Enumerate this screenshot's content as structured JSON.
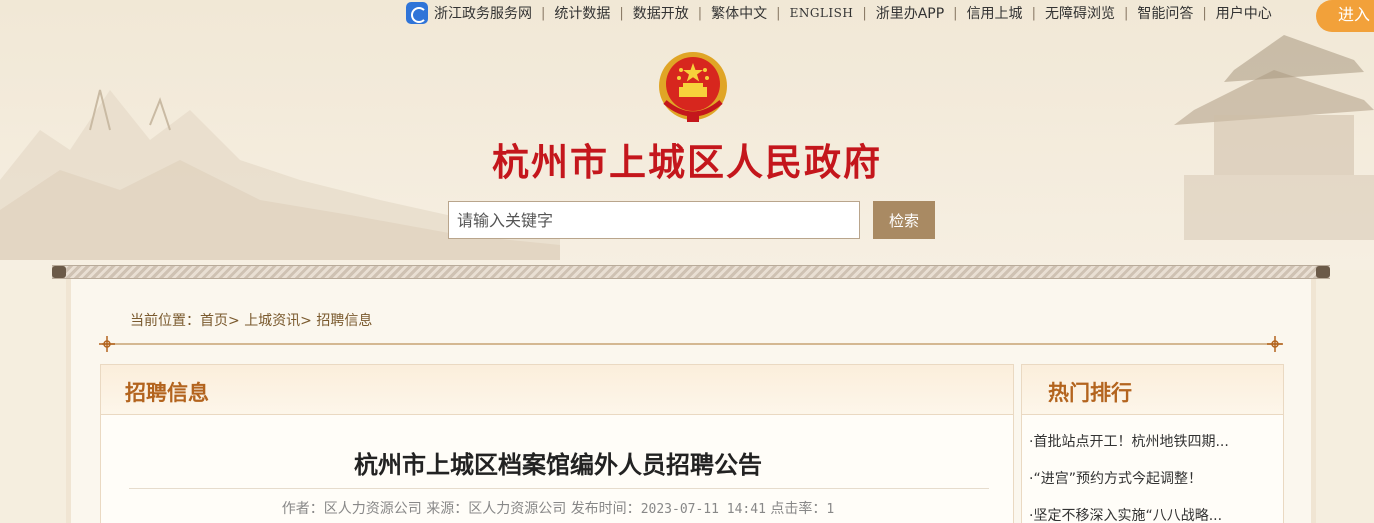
{
  "topbar": {
    "links": [
      {
        "label": "浙江政务服务网"
      },
      {
        "label": "统计数据"
      },
      {
        "label": "数据开放"
      },
      {
        "label": "繁体中文"
      },
      {
        "label": "ENGLISH"
      },
      {
        "label": "浙里办APP"
      },
      {
        "label": "信用上城"
      },
      {
        "label": "无障碍浏览"
      },
      {
        "label": "智能问答"
      },
      {
        "label": "用户中心"
      }
    ],
    "separator": "|",
    "enter_label": "进入"
  },
  "header": {
    "site_title": "杭州市上城区人民政府"
  },
  "search": {
    "placeholder": "请输入关键字",
    "button_label": "检索"
  },
  "breadcrumb": {
    "prefix": "当前位置：",
    "items": [
      "首页>",
      "上城资讯>",
      "招聘信息"
    ]
  },
  "main": {
    "section_title": "招聘信息",
    "article_title": "杭州市上城区档案馆编外人员招聘公告",
    "meta": {
      "author_label": "作者：",
      "author": "区人力资源公司",
      "source_label": "来源：",
      "source": "区人力资源公司",
      "published_label": "发布时间：",
      "published": "2023-07-11 14:41",
      "clicks_label": "点击率：",
      "clicks": "1"
    }
  },
  "sidebar": {
    "section_title": "热门排行",
    "items": [
      {
        "label": "·首批站点开工！杭州地铁四期..."
      },
      {
        "label": "·“进宫”预约方式今起调整！"
      },
      {
        "label": "·坚定不移深入实施“八八战略..."
      }
    ]
  },
  "colors": {
    "brand_red": "#c4161c",
    "accent_brown": "#b3641e",
    "button_brown": "#a98a63",
    "enter_orange": "#f2a13a"
  },
  "icons": [
    "zhejiang-service-icon",
    "national-emblem-icon",
    "ornament-icon"
  ]
}
